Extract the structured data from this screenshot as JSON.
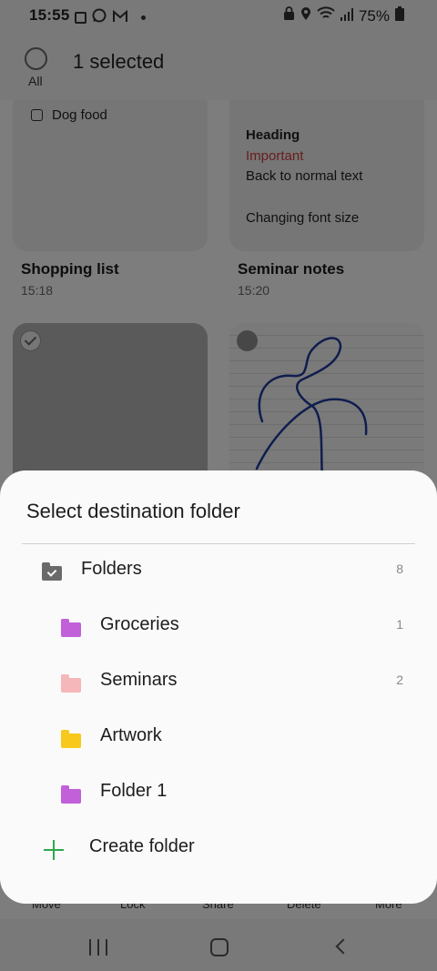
{
  "status_bar": {
    "time": "15:55",
    "battery": "75%",
    "notification_icons": [
      "gallery-icon",
      "whatsapp-icon",
      "gmail-icon",
      "dot-icon"
    ],
    "system_icons": [
      "lock-icon",
      "location-icon",
      "wifi-icon",
      "signal-icon",
      "battery-icon"
    ]
  },
  "top_bar": {
    "all_label": "All",
    "title": "1 selected"
  },
  "notes": [
    {
      "title": "Shopping list",
      "time": "15:18",
      "lines": [
        "Dog food"
      ],
      "selected": false
    },
    {
      "title": "Seminar notes",
      "time": "15:20",
      "lines": [
        "Heading",
        "Important",
        "Back to normal text",
        "Changing font size"
      ],
      "selected": false
    },
    {
      "selected": true
    },
    {
      "selected": false
    }
  ],
  "bottom_actions": [
    "Move",
    "Lock",
    "Share",
    "Delete",
    "More"
  ],
  "sheet": {
    "title": "Select destination folder",
    "root": {
      "label": "Folders",
      "count": "8"
    },
    "folders": [
      {
        "name": "Groceries",
        "count": "1",
        "color": "#c160d8"
      },
      {
        "name": "Seminars",
        "count": "2",
        "color": "#f6b7bb"
      },
      {
        "name": "Artwork",
        "count": "",
        "color": "#f8c81c"
      },
      {
        "name": "Folder 1",
        "count": "",
        "color": "#c160d8"
      }
    ],
    "create_label": "Create folder",
    "create_color": "#2ea84e"
  },
  "nav_bar": [
    "recents-icon",
    "home-icon",
    "back-icon"
  ]
}
